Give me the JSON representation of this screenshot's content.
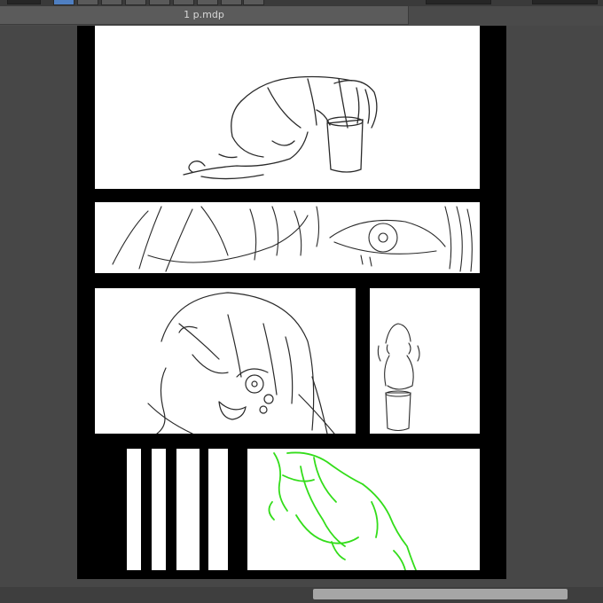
{
  "document": {
    "tab_title": "1 p.mdp"
  },
  "colors": {
    "toolbar_active": "#4f7fc2",
    "sketch_line": "#2a2a2a",
    "draft_line": "#33dd1a"
  },
  "toolbar": {
    "icons": [
      "tool-icon",
      "tool-icon",
      "tool-icon",
      "tool-icon",
      "tool-icon",
      "tool-icon",
      "tool-icon",
      "tool-icon"
    ]
  },
  "panels": [
    {
      "name": "panel-crouching-figure-bucket"
    },
    {
      "name": "panel-eye-closeup"
    },
    {
      "name": "panel-girl-holding-head"
    },
    {
      "name": "panel-small-figure-bucket"
    },
    {
      "name": "panel-vertical-bars"
    },
    {
      "name": "panel-green-draft-figure"
    }
  ]
}
